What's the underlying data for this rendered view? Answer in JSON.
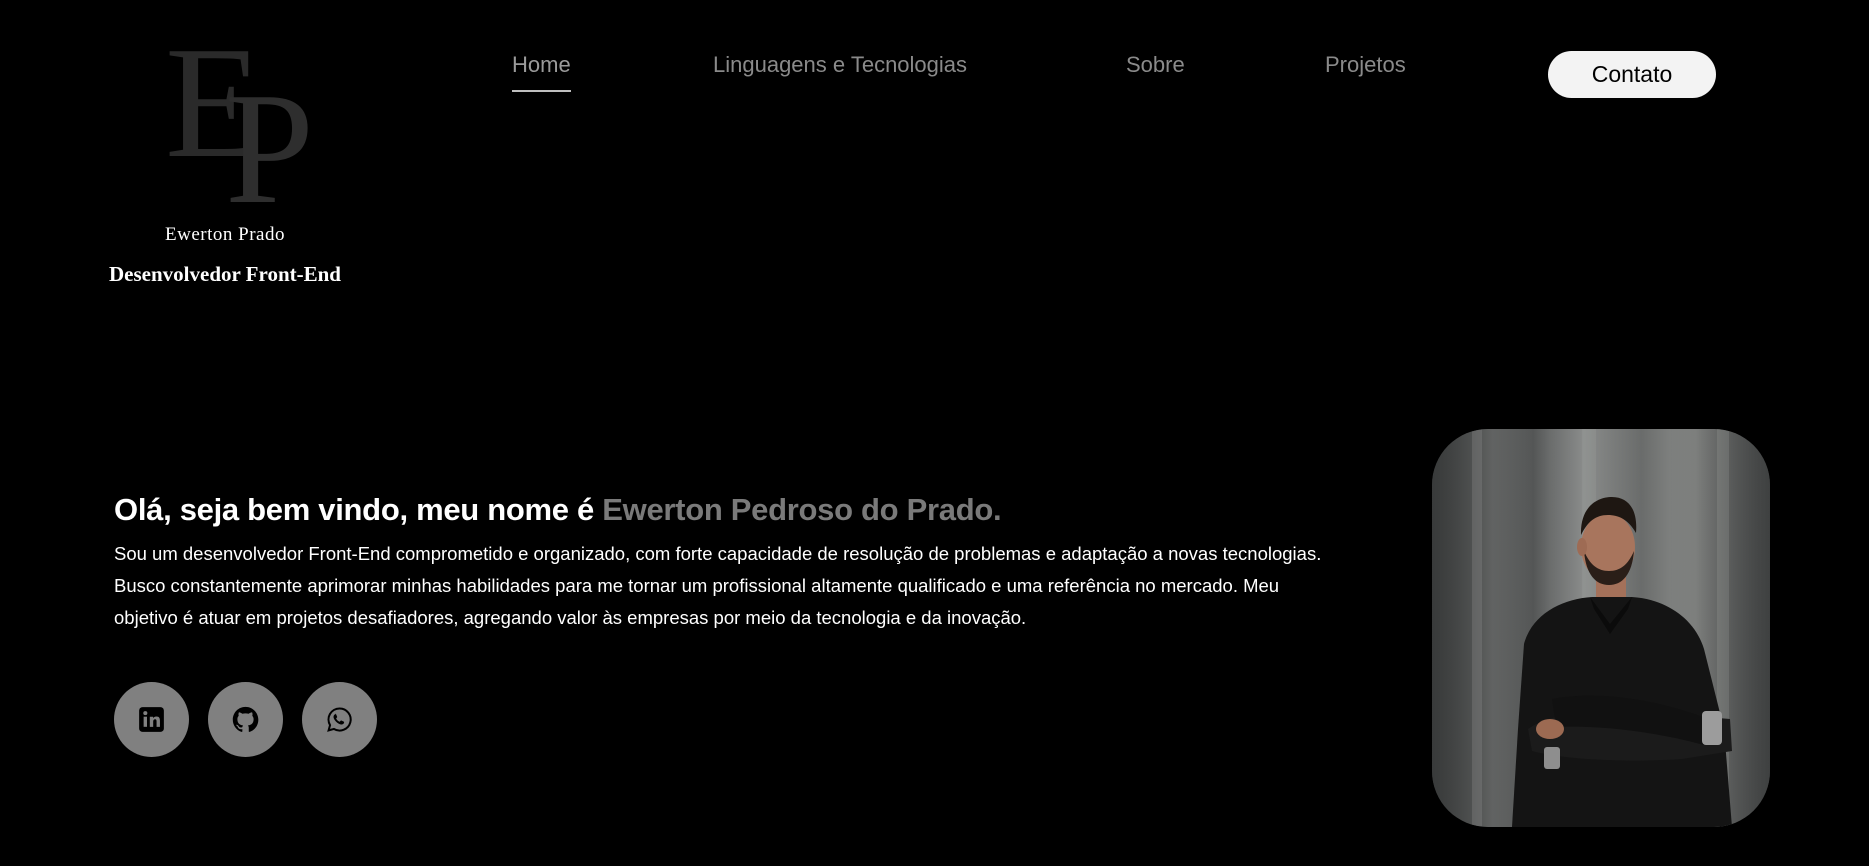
{
  "logo": {
    "monogram_first": "E",
    "monogram_second": "P",
    "name": "Ewerton Prado",
    "role": "Desenvolvedor Front-End"
  },
  "nav": {
    "items": [
      {
        "label": "Home",
        "active": true
      },
      {
        "label": "Linguagens e Tecnologias",
        "active": false
      },
      {
        "label": "Sobre",
        "active": false
      },
      {
        "label": "Projetos",
        "active": false
      }
    ],
    "contact_label": "Contato"
  },
  "hero": {
    "title_prefix": "Olá, seja bem vindo, meu nome é ",
    "title_name": "Ewerton Pedroso do Prado.",
    "description": "Sou um desenvolvedor Front-End comprometido e organizado, com forte capacidade de resolução de problemas e adaptação a novas tecnologias. Busco constantemente aprimorar minhas habilidades para me tornar um profissional altamente qualificado e uma referência no mercado. Meu objetivo é atuar em projetos desafiadores, agregando valor às empresas por meio da tecnologia e da inovação."
  },
  "socials": [
    {
      "icon": "linkedin-icon"
    },
    {
      "icon": "github-icon"
    },
    {
      "icon": "whatsapp-icon"
    }
  ],
  "colors": {
    "background": "#000000",
    "accent_gray": "#7a7a7a",
    "button_light": "#f3f3f3",
    "social_circle": "#808080"
  }
}
